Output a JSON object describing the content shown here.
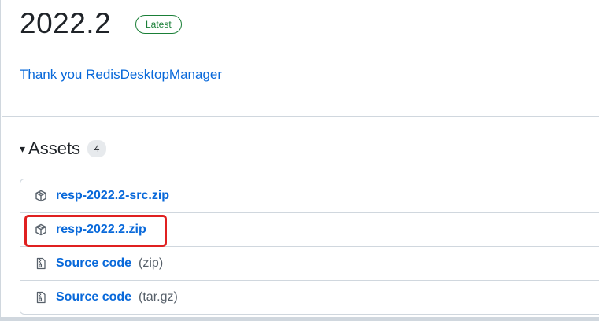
{
  "release": {
    "title": "2022.2",
    "badge": "Latest",
    "notes_link": "Thank you RedisDesktopManager"
  },
  "assets": {
    "caret": "▾",
    "title": "Assets",
    "count": "4",
    "items": [
      {
        "name": "resp-2022.2-src.zip",
        "suffix": "",
        "icon": "package-icon"
      },
      {
        "name": "resp-2022.2.zip",
        "suffix": "",
        "icon": "package-icon"
      },
      {
        "name": "Source code",
        "suffix": "(zip)",
        "icon": "file-zip-icon"
      },
      {
        "name": "Source code",
        "suffix": "(tar.gz)",
        "icon": "file-zip-icon"
      }
    ]
  },
  "colors": {
    "link": "#0969da",
    "badge_green": "#1a7f37",
    "highlight_red": "#e02020",
    "border": "#d0d7de"
  }
}
